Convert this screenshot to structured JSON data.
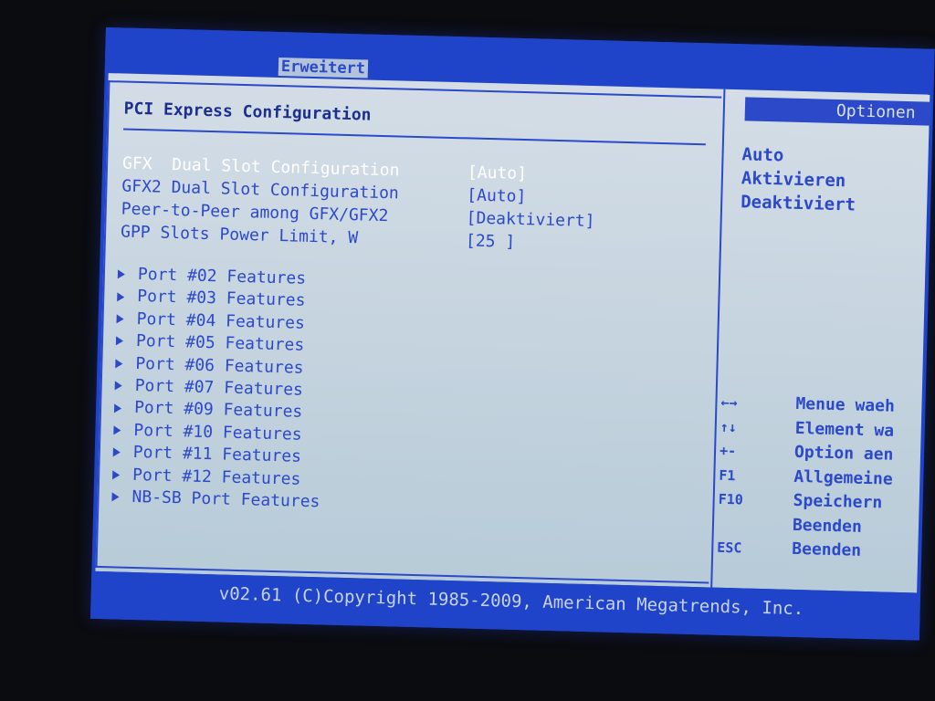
{
  "header": {
    "active_tab": "Erweitert"
  },
  "section": {
    "title": "PCI Express Configuration"
  },
  "settings": [
    {
      "label": "GFX  Dual Slot Configuration",
      "value": "[Auto]"
    },
    {
      "label": "GFX2 Dual Slot Configuration",
      "value": "[Auto]"
    },
    {
      "label": "Peer-to-Peer among GFX/GFX2",
      "value": "[Deaktiviert]"
    },
    {
      "label": "GPP Slots Power Limit, W",
      "value": "[25 ]"
    }
  ],
  "submenus": [
    "Port #02 Features",
    "Port #03 Features",
    "Port #04 Features",
    "Port #05 Features",
    "Port #06 Features",
    "Port #07 Features",
    "Port #09 Features",
    "Port #10 Features",
    "Port #11 Features",
    "Port #12 Features",
    "NB-SB Port Features"
  ],
  "options": {
    "title": "Optionen",
    "items": [
      "Auto",
      "Aktivieren",
      "Deaktiviert"
    ]
  },
  "keys": [
    {
      "key": "←→",
      "desc": "Menue waeh"
    },
    {
      "key": "↑↓",
      "desc": "Element wa"
    },
    {
      "key": "+-",
      "desc": "Option aen"
    },
    {
      "key": "F1",
      "desc": "Allgemeine"
    },
    {
      "key": "F10",
      "desc": "Speichern"
    },
    {
      "key": "",
      "desc": "Beenden"
    },
    {
      "key": "ESC",
      "desc": "Beenden"
    }
  ],
  "footer": {
    "copyright": "v02.61 (C)Copyright 1985-2009, American Megatrends, Inc."
  },
  "colors": {
    "frame_blue": "#1f43c9",
    "text_blue": "#2b49c9",
    "panel_bg": "#c6d4df",
    "selected_text": "#ffffff"
  }
}
